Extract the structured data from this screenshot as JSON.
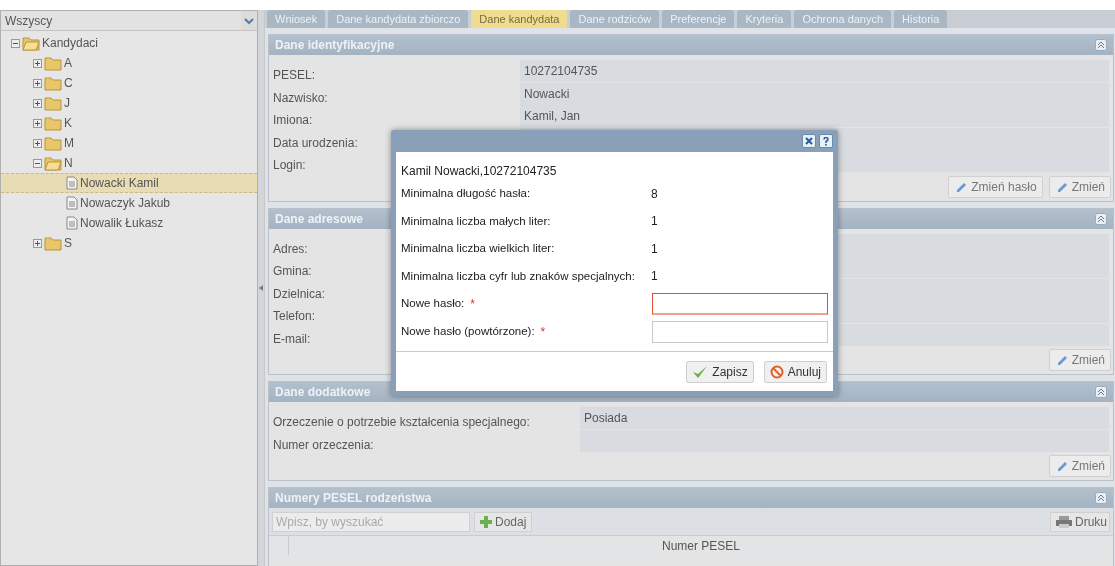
{
  "filter": {
    "value": "Wszyscy"
  },
  "tree": [
    {
      "label": "Kandydaci",
      "kind": "folder",
      "expanded": true,
      "selected": false,
      "children": [
        {
          "label": "A",
          "kind": "folder",
          "expanded": false,
          "selected": false
        },
        {
          "label": "C",
          "kind": "folder",
          "expanded": false,
          "selected": false
        },
        {
          "label": "J",
          "kind": "folder",
          "expanded": false,
          "selected": false
        },
        {
          "label": "K",
          "kind": "folder",
          "expanded": false,
          "selected": false
        },
        {
          "label": "M",
          "kind": "folder",
          "expanded": false,
          "selected": false
        },
        {
          "label": "N",
          "kind": "folder",
          "expanded": true,
          "selected": false,
          "children": [
            {
              "label": "Nowacki Kamil",
              "kind": "file",
              "selected": true
            },
            {
              "label": "Nowaczyk Jakub",
              "kind": "file",
              "selected": false
            },
            {
              "label": "Nowalik Łukasz",
              "kind": "file",
              "selected": false
            }
          ]
        },
        {
          "label": "S",
          "kind": "folder",
          "expanded": false,
          "selected": false
        }
      ]
    }
  ],
  "tabs": [
    {
      "label": "Wniosek",
      "selected": false
    },
    {
      "label": "Dane kandydata zbiorczo",
      "selected": false
    },
    {
      "label": "Dane kandydata",
      "selected": true
    },
    {
      "label": "Dane rodziców",
      "selected": false
    },
    {
      "label": "Preferencje",
      "selected": false
    },
    {
      "label": "Kryteria",
      "selected": false
    },
    {
      "label": "Ochrona danych",
      "selected": false
    },
    {
      "label": "Historia",
      "selected": false
    }
  ],
  "sections": [
    {
      "title": "Dane identyfikacyjne",
      "rows": [
        {
          "label": "PESEL:",
          "value": "10272104735"
        },
        {
          "label": "Nazwisko:",
          "value": "Nowacki"
        },
        {
          "label": "Imiona:",
          "value": "Kamil, Jan"
        },
        {
          "label": "Data urodzenia:"
        },
        {
          "label": "Login:"
        }
      ],
      "buttons": [
        "Zmień hasło",
        "Zmień"
      ]
    },
    {
      "title": "Dane adresowe",
      "rows": [
        {
          "label": "Adres:"
        },
        {
          "label": "Gmina:"
        },
        {
          "label": "Dzielnica:"
        },
        {
          "label": "Telefon:"
        },
        {
          "label": "E-mail:"
        }
      ],
      "buttons": [
        "Zmień"
      ]
    },
    {
      "title": "Dane dodatkowe",
      "rows": [
        {
          "label": "Orzeczenie o potrzebie kształcenia specjalnego:",
          "value": "Posiada"
        },
        {
          "label": "Numer orzeczenia:"
        }
      ],
      "buttons": [
        "Zmień"
      ]
    }
  ],
  "siblings": {
    "title": "Numery PESEL rodzeństwa",
    "search": {
      "placeholder": "Wpisz, by wyszukać"
    },
    "add_button": "Dodaj",
    "print_button": "Druku",
    "columns": [
      "Numer PESEL"
    ]
  },
  "dialog": {
    "heading": "Kamil Nowacki,10272104735",
    "rules": [
      {
        "label": "Minimalna długość hasła:",
        "value": "8"
      },
      {
        "label": "Minimalna liczba małych liter:",
        "value": "1"
      },
      {
        "label": "Minimalna liczba wielkich liter:",
        "value": "1"
      },
      {
        "label": "Minimalna liczba cyfr lub znaków specjalnych:",
        "value": "1"
      }
    ],
    "fields": [
      {
        "label": "Nowe hasło:",
        "required_mark": "*",
        "invalid": true
      },
      {
        "label": "Nowe hasło (powtórzone):",
        "required_mark": "*",
        "invalid": false
      }
    ],
    "buttons": [
      {
        "label": "Zapisz",
        "kind": "save"
      },
      {
        "label": "Anuluj",
        "kind": "cancel"
      }
    ]
  }
}
